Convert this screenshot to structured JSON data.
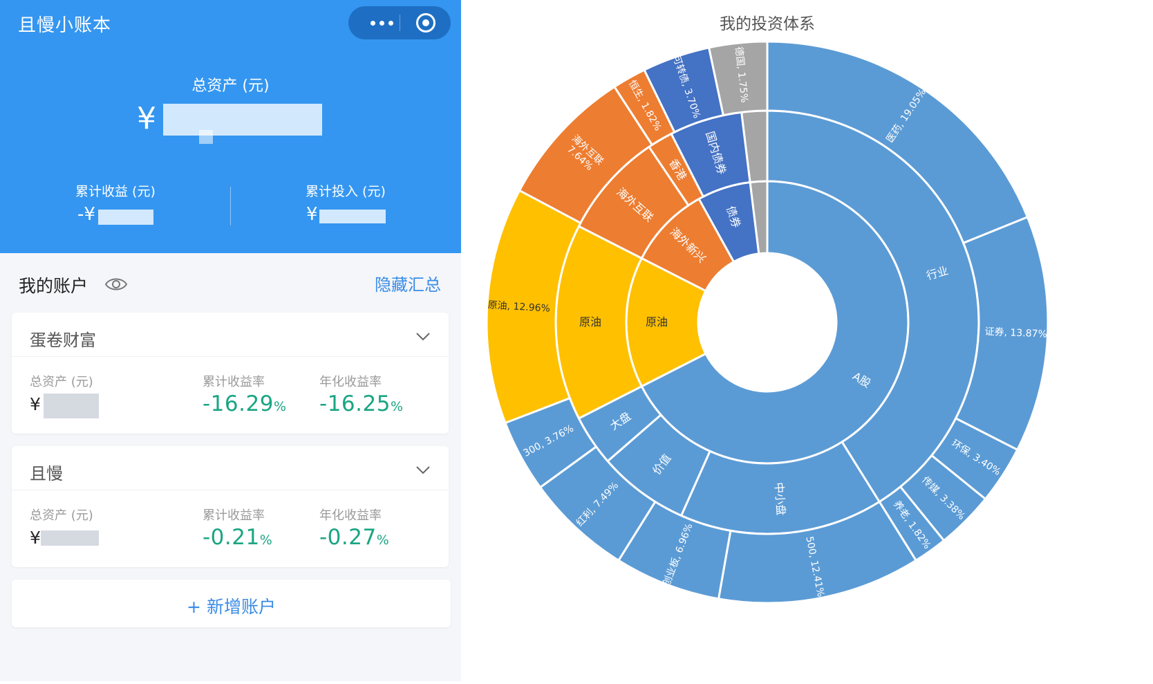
{
  "app": {
    "title": "且慢小账本",
    "total_label": "总资产 (元)",
    "total_prefix": "¥",
    "income_label": "累计收益 (元)",
    "income_prefix": "-¥",
    "invest_label": "累计投入 (元)",
    "invest_prefix": "¥"
  },
  "accounts": {
    "title": "我的账户",
    "hide_label": "隐藏汇总",
    "total_label": "总资产 (元)",
    "cum_label": "累计收益率",
    "ann_label": "年化收益率",
    "currency": "¥",
    "pct_unit": "%",
    "items": [
      {
        "name": "蛋卷财富",
        "cum": "-16.29",
        "ann": "-16.25"
      },
      {
        "name": "且慢",
        "cum": "-0.21",
        "ann": "-0.27"
      }
    ],
    "add_label": "+ 新增账户"
  },
  "colors": {
    "header_blue": "#3496f0",
    "green_pct": "#1aa583",
    "link_blue": "#3a8be6",
    "slice_blue": "#5b9bd5",
    "slice_orange": "#ed7d31",
    "slice_yellow": "#ffc000",
    "slice_darkblue": "#4472c4",
    "slice_gray": "#a5a5a5"
  },
  "chart_data": {
    "type": "sunburst",
    "title": "我的投资体系",
    "rings": [
      [
        {
          "label": "A股",
          "color": "slice_blue",
          "start": 0,
          "end": 243
        },
        {
          "label": "原油",
          "color": "slice_yellow",
          "start": 243,
          "end": 297
        },
        {
          "label": "海外新兴",
          "color": "slice_orange",
          "start": 297,
          "end": 331
        },
        {
          "label": "债券",
          "color": "slice_darkblue",
          "start": 331,
          "end": 353
        },
        {
          "label": "",
          "color": "slice_gray",
          "start": 353,
          "end": 360
        }
      ],
      [
        {
          "label": "行业",
          "color": "slice_blue",
          "start": 0,
          "end": 148
        },
        {
          "label": "中小盘",
          "color": "slice_blue",
          "start": 148,
          "end": 204
        },
        {
          "label": "价值",
          "color": "slice_blue",
          "start": 204,
          "end": 229
        },
        {
          "label": "大盘",
          "color": "slice_blue",
          "start": 229,
          "end": 243
        },
        {
          "label": "原油",
          "color": "slice_yellow",
          "start": 243,
          "end": 297
        },
        {
          "label": "海外互联",
          "color": "slice_orange",
          "start": 297,
          "end": 326
        },
        {
          "label": "香港",
          "color": "slice_orange",
          "start": 326,
          "end": 333
        },
        {
          "label": "国内债券",
          "color": "slice_darkblue",
          "start": 333,
          "end": 353
        },
        {
          "label": "",
          "color": "slice_gray",
          "start": 353,
          "end": 360
        }
      ],
      [
        {
          "label": "医药, 19.05%",
          "color": "slice_blue",
          "start": 0,
          "end": 68
        },
        {
          "label": "证券, 13.87%",
          "color": "slice_blue",
          "start": 68,
          "end": 117
        },
        {
          "label": "环保, 3.40%",
          "color": "slice_blue",
          "start": 117,
          "end": 129
        },
        {
          "label": "传媒, 3.38%",
          "color": "slice_blue",
          "start": 129,
          "end": 141
        },
        {
          "label": "养老, 1.82%",
          "color": "slice_blue",
          "start": 141,
          "end": 148
        },
        {
          "label": "500, 12.41%",
          "color": "slice_blue",
          "start": 148,
          "end": 190
        },
        {
          "label": "创业板, 6.96%",
          "color": "slice_blue",
          "start": 190,
          "end": 212
        },
        {
          "label": "红利, 7.49%",
          "color": "slice_blue",
          "start": 212,
          "end": 234
        },
        {
          "label": "300, 3.76%",
          "color": "slice_blue",
          "start": 234,
          "end": 249
        },
        {
          "label": "原油, 12.96%",
          "color": "slice_yellow",
          "start": 249,
          "end": 298
        },
        {
          "label": "海外互联\n7.64%",
          "color": "slice_orange",
          "start": 298,
          "end": 327
        },
        {
          "label": "恒生, 1.82%",
          "color": "slice_orange",
          "start": 327,
          "end": 334
        },
        {
          "label": "可转债, 3.70%",
          "color": "slice_darkblue",
          "start": 334,
          "end": 348
        },
        {
          "label": "德国, 1.75%",
          "color": "slice_gray",
          "start": 348,
          "end": 360
        }
      ]
    ]
  }
}
